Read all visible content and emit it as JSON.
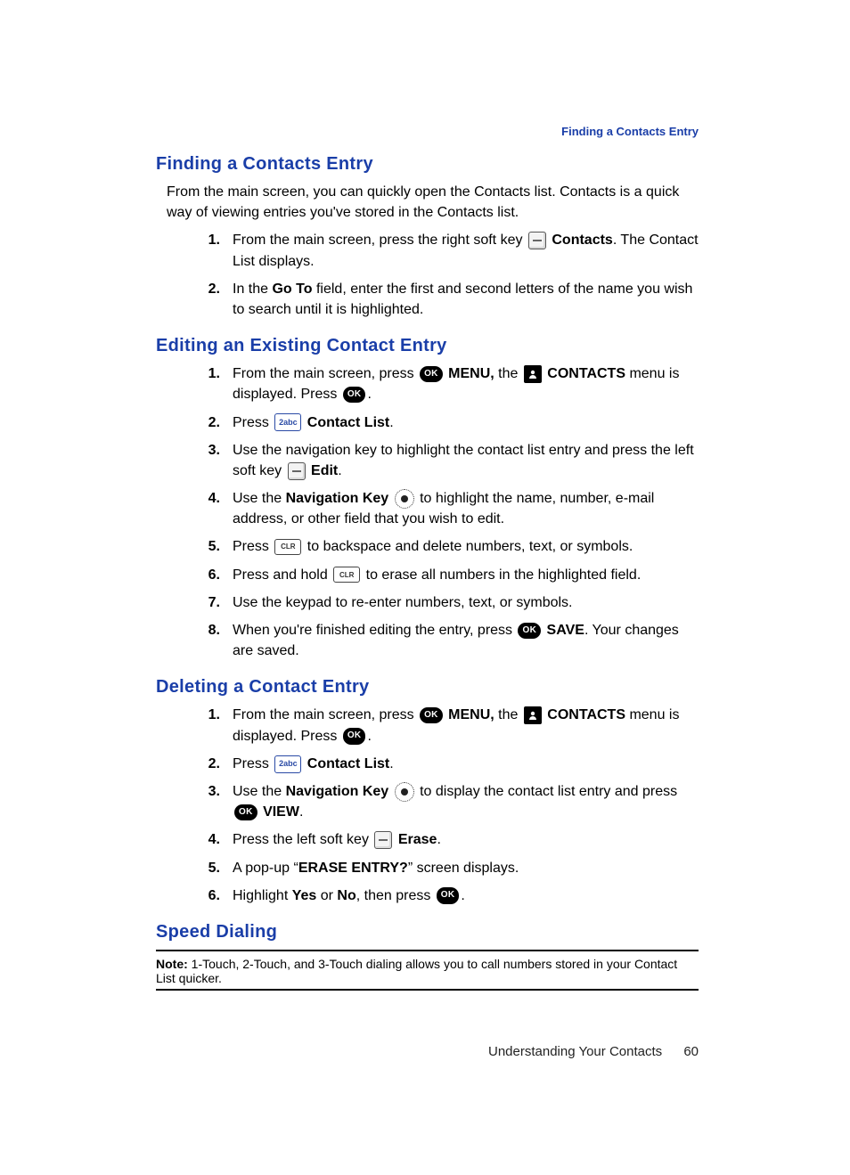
{
  "running_header": "Finding a Contacts Entry",
  "sections": {
    "find": {
      "heading": "Finding a Contacts Entry",
      "intro": "From the main screen, you can quickly open the Contacts list. Contacts is a quick way of viewing entries you've stored in the Contacts list.",
      "steps": {
        "s1a": "From the main screen, press the right soft key",
        "s1b": "Contacts",
        "s1c": ". The Contact List displays.",
        "s2a": "In the ",
        "s2b": "Go To",
        "s2c": " field, enter the first and second letters of the name you wish to search until it is highlighted."
      }
    },
    "edit": {
      "heading": "Editing an Existing Contact Entry",
      "steps": {
        "s1a": "From the main screen, press ",
        "s1b": "MENU,",
        "s1c": " the ",
        "s1d": "CONTACTS",
        "s1e": " menu is displayed. Press ",
        "s1f": ".",
        "s2a": "Press ",
        "s2b": "Contact List",
        "s2c": ".",
        "s3a": "Use the navigation key to highlight the contact list entry and press the left soft key ",
        "s3b": "Edit",
        "s3c": ".",
        "s4a": "Use the ",
        "s4b": "Navigation Key",
        "s4c": " to highlight the name, number, e-mail address, or other field that you wish to edit.",
        "s5a": "Press ",
        "s5b": " to backspace and delete numbers, text, or symbols.",
        "s6a": "Press and hold ",
        "s6b": " to erase all numbers in the highlighted field.",
        "s7": "Use the keypad to re-enter numbers, text, or symbols.",
        "s8a": "When you're finished editing the entry, press ",
        "s8b": "SAVE",
        "s8c": ". Your changes are saved."
      }
    },
    "delete": {
      "heading": "Deleting a Contact Entry",
      "steps": {
        "s1a": "From the main screen, press ",
        "s1b": "MENU,",
        "s1c": " the ",
        "s1d": "CONTACTS",
        "s1e": " menu is displayed. Press ",
        "s1f": ".",
        "s2a": "Press ",
        "s2b": "Contact List",
        "s2c": ".",
        "s3a": "Use the ",
        "s3b": "Navigation Key",
        "s3c": " to display the contact list entry and press ",
        "s3d": "VIEW",
        "s3e": ".",
        "s4a": "Press the left soft key ",
        "s4b": "Erase",
        "s4c": ".",
        "s5a": "A pop-up “",
        "s5b": "ERASE ENTRY?",
        "s5c": "” screen displays.",
        "s6a": "Highlight ",
        "s6b": "Yes",
        "s6c": " or ",
        "s6d": "No",
        "s6e": ", then press ",
        "s6f": "."
      }
    },
    "speed": {
      "heading": "Speed Dialing",
      "note_label": "Note:",
      "note_body": " 1-Touch, 2-Touch, and 3-Touch dialing allows you to call numbers stored in your Contact List quicker."
    }
  },
  "icons": {
    "ok": "OK",
    "two_abc": "2abc",
    "clr": "CLR",
    "person": "★"
  },
  "footer": {
    "section": "Understanding Your Contacts",
    "page": "60"
  }
}
